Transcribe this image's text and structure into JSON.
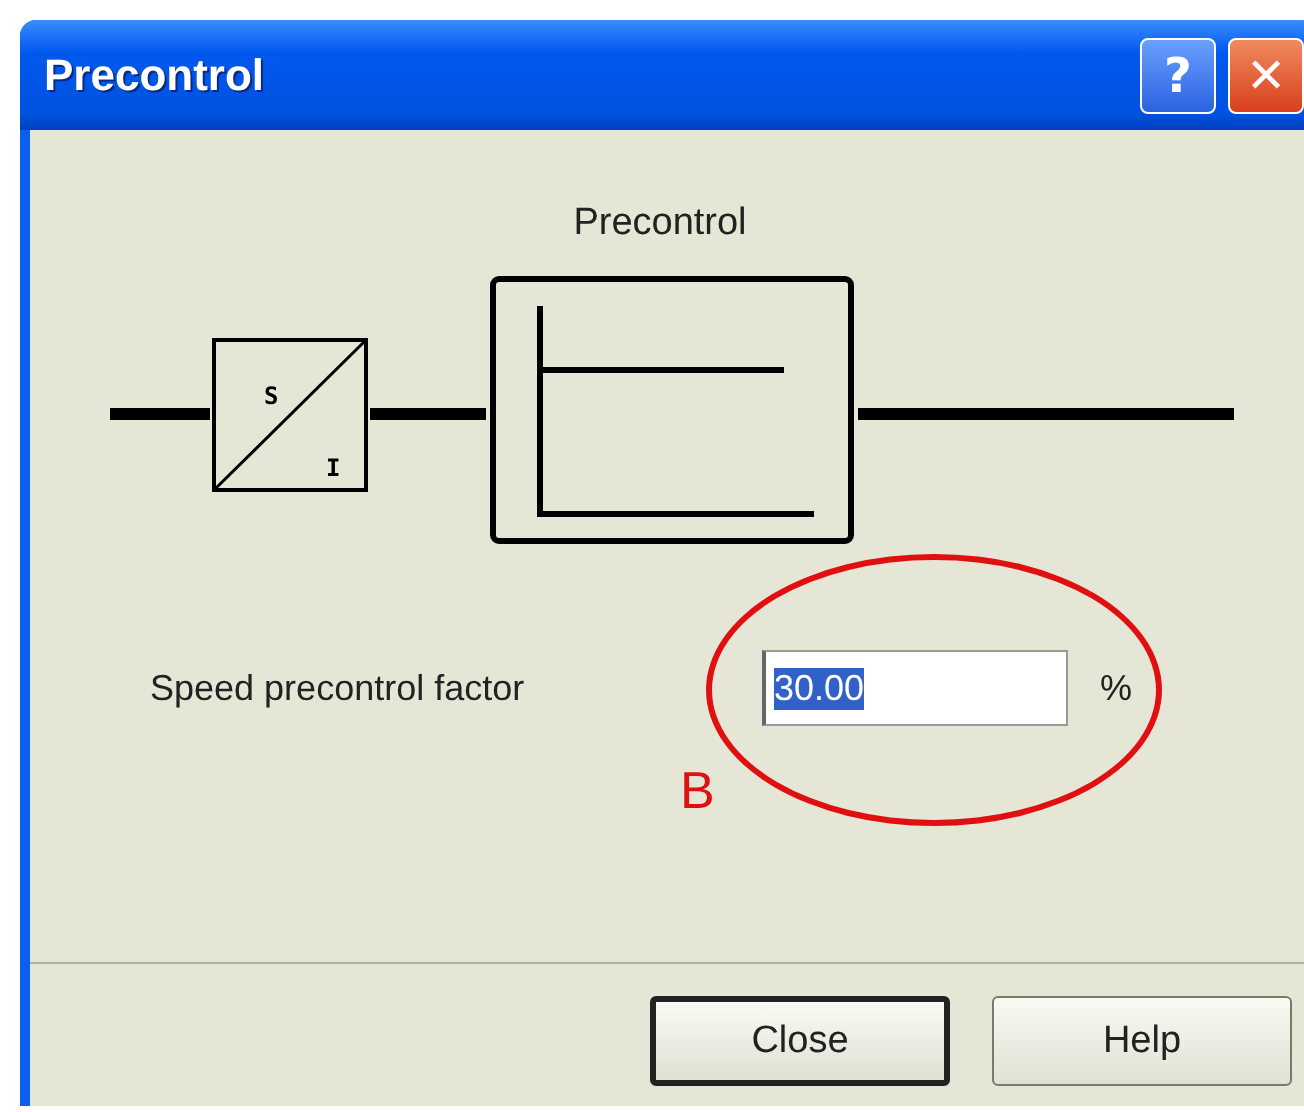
{
  "window": {
    "title": "Precontrol",
    "title_buttons": [
      {
        "kind": "help",
        "label": "?"
      },
      {
        "kind": "close",
        "label": "✕"
      }
    ]
  },
  "diagram": {
    "title": "Precontrol",
    "converter_top": "S",
    "converter_bottom": "I"
  },
  "field": {
    "label": "Speed precontrol factor",
    "value": "30.00",
    "selected": true,
    "unit": "%"
  },
  "annotation": {
    "label": "B"
  },
  "buttons": [
    {
      "label": "Close",
      "default": true
    },
    {
      "label": "Help",
      "default": false
    }
  ]
}
